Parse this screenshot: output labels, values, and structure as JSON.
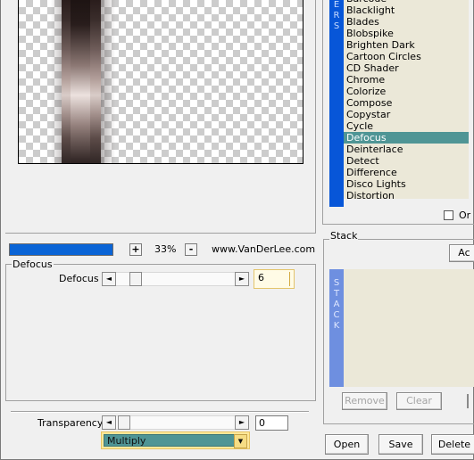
{
  "preview": {},
  "zoom": {
    "progress": 1.0,
    "plus_label": "+",
    "minus_label": "-",
    "value": "33%",
    "credit": "www.VanDerLee.com"
  },
  "filters": {
    "tab_text_visible": "ERS",
    "items": [
      "Barcode",
      "Blacklight",
      "Blades",
      "Blobspike",
      "Brighten Dark",
      "Cartoon Circles",
      "CD Shader",
      "Chrome",
      "Colorize",
      "Compose",
      "Copystar",
      "Cycle",
      "Defocus",
      "Deinterlace",
      "Detect",
      "Difference",
      "Disco Lights",
      "Distortion"
    ],
    "selected": "Defocus",
    "checkbox_label": "Or"
  },
  "defocus_group": {
    "title": "Defocus",
    "param_label": "Defocus",
    "param_value": "6",
    "left_arrow": "◄",
    "right_arrow": "►"
  },
  "transparency": {
    "label": "Transparency",
    "value": "0",
    "blend_mode": "Multiply",
    "dropdown_arrow": "▼"
  },
  "stack": {
    "title": "Stack",
    "tab_text": "STACK",
    "add_label": "Ac",
    "remove_label": "Remove",
    "clear_label": "Clear"
  },
  "actions": {
    "open_label": "Open",
    "save_label": "Save",
    "delete_label": "Delete"
  },
  "colors": {
    "selection": "#4f9595",
    "filters_tab": "#0756d8",
    "stack_tab": "#6e8fe0",
    "list_bg": "#ebe8d8",
    "highlight_box": "#fffbe6",
    "progress": "#0a64d6"
  }
}
